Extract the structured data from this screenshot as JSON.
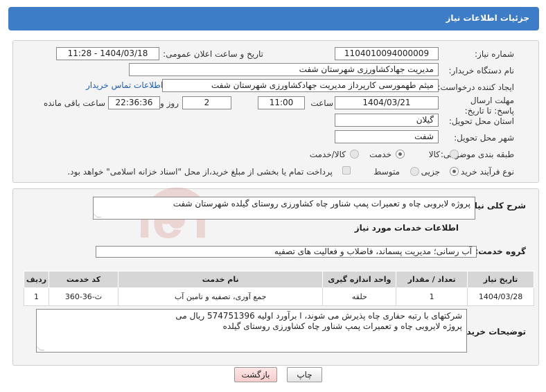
{
  "header": {
    "title": "جزئیات اطلاعات نیاز"
  },
  "form": {
    "need_number_label": "شماره نیاز:",
    "need_number": "1104010094000009",
    "announce_label": "تاریخ و ساعت اعلان عمومی:",
    "announce_value": "1404/03/18 - 11:28",
    "buyer_org_label": "نام دستگاه خریدار:",
    "buyer_org": "مدیریت جهادکشاورزی شهرستان شفت",
    "creator_label": "ایجاد کننده درخواست:",
    "creator": "میثم طهمورسی کارپرداز مدیریت جهادکشاورزی شهرستان شفت",
    "contact_link": "اطلاعات تماس خریدار",
    "deadline_label": "مهلت ارسال پاسخ: تا تاریخ:",
    "deadline_date": "1404/03/21",
    "time_label": "ساعت",
    "deadline_time": "11:00",
    "days_value": "2",
    "days_label": "روز و",
    "remaining_value": "22:36:36",
    "remaining_label": "ساعت باقی مانده",
    "province_label": "استان محل تحویل:",
    "province": "گیلان",
    "city_label": "شهر محل تحویل:",
    "city": "شفت",
    "category_label": "طبقه بندی موضوعی:",
    "category_options": [
      "کالا",
      "خدمت",
      "کالا/خدمت"
    ],
    "category_selected": "خدمت",
    "process_label": "نوع فرآیند خرید :",
    "process_options": [
      "جزیی",
      "متوسط"
    ],
    "process_selected": "جزیی",
    "payment_note": "پرداخت تمام یا بخشی از مبلغ خرید،از محل \"اسناد خزانه اسلامی\" خواهد بود."
  },
  "details": {
    "summary_label": "شرح کلی نیاز:",
    "summary": "پروژه لایروبی چاه و تعمیرات پمپ شناور چاه کشاورزی روستای گیلده شهرستان شفت",
    "services_heading": "اطلاعات خدمات مورد نیاز",
    "group_label": "گروه خدمت:",
    "group_value": "آب رسانی؛ مدیریت پسماند، فاضلاب و فعالیت های تصفیه",
    "table": {
      "headers": [
        "ردیف",
        "کد خدمت",
        "نام خدمت",
        "واحد اندازه گیری",
        "تعداد / مقدار",
        "تاریخ نیاز"
      ],
      "rows": [
        [
          "1",
          "ث-36-360",
          "جمع آوری، تصفیه و تامین آب",
          "حلقه",
          "1",
          "1404/03/28"
        ]
      ]
    },
    "notes_label": "توضیحات خریدار:",
    "notes_line1": "شرکتهای با  رتبه حفاری چاه پذیرش می شوند، ا برآورد اولیه  574751396 ریال می",
    "notes_line2": "پروژه لایروبی چاه و تعمیرات پمپ شناور چاه کشاورزی روستای گیلده"
  },
  "buttons": {
    "print": "چاپ",
    "back": "بازگشت"
  },
  "watermark": {
    "text": "AriaTender.neT"
  },
  "colors": {
    "header_bg": "#3d7cc6",
    "link": "#1f5fb5",
    "back_btn": "#f6cccc",
    "watermark": "#c0392b"
  }
}
